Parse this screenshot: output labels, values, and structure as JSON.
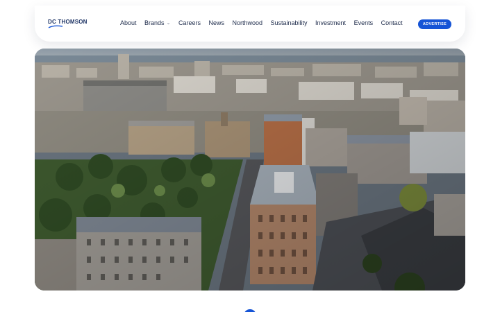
{
  "brand": {
    "logo_text": "DC THOMSON"
  },
  "nav": {
    "items": [
      {
        "label": "About"
      },
      {
        "label": "Brands",
        "has_dropdown": true
      },
      {
        "label": "Careers"
      },
      {
        "label": "News"
      },
      {
        "label": "Northwood"
      },
      {
        "label": "Sustainability"
      },
      {
        "label": "Investment"
      },
      {
        "label": "Events"
      },
      {
        "label": "Contact"
      }
    ],
    "cta_label": "ADVERTISE"
  },
  "hero": {
    "image_subject": "aerial-city-photo"
  },
  "colors": {
    "accent": "#1554d6",
    "brand_navy": "#1f3566"
  },
  "icons": {
    "dropdown": "chevron-down-icon",
    "logo_mark": "swoosh-logo-icon"
  }
}
